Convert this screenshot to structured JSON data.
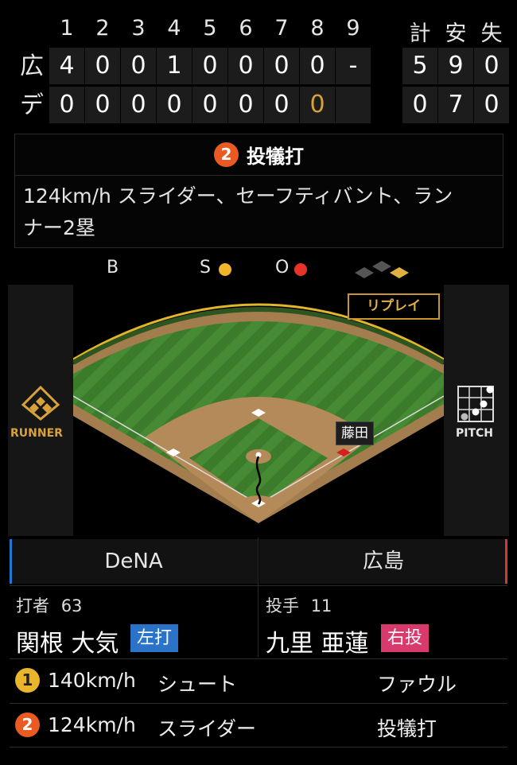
{
  "scoreboard": {
    "innings": [
      "1",
      "2",
      "3",
      "4",
      "5",
      "6",
      "7",
      "8",
      "9"
    ],
    "totals_headers": [
      "計",
      "安",
      "失"
    ],
    "teams": [
      {
        "abbr": "広",
        "innings": [
          "4",
          "0",
          "0",
          "1",
          "0",
          "0",
          "0",
          "0",
          "-"
        ],
        "totals": [
          "5",
          "9",
          "0"
        ]
      },
      {
        "abbr": "デ",
        "innings": [
          "0",
          "0",
          "0",
          "0",
          "0",
          "0",
          "0",
          "0",
          ""
        ],
        "totals": [
          "0",
          "7",
          "0"
        ]
      }
    ]
  },
  "play": {
    "number": "2",
    "title": "投犠打",
    "line1": "124km/h スライダー、セーフティバント、ラン",
    "line2": "ナー2塁"
  },
  "count": {
    "balls_label": "B",
    "strikes_label": "S",
    "outs_label": "O",
    "balls": 0,
    "strikes": 1,
    "outs": 1,
    "strike_color": "#f0b52a",
    "out_color": "#e8332a"
  },
  "field": {
    "replay_label": "リプレイ",
    "runner_label": "RUNNER",
    "pitch_label": "PITCH",
    "fielder_name": "藤田"
  },
  "teams": {
    "away": {
      "name": "DeNA",
      "color": "#1f78d1"
    },
    "home": {
      "name": "広島",
      "color": "#d23a2f"
    }
  },
  "batter": {
    "role": "打者",
    "number": "63",
    "name": "関根 大気",
    "hand": "左打",
    "hand_color": "#2a73c9"
  },
  "pitcher": {
    "role": "投手",
    "number": "11",
    "name": "九里 亜蓮",
    "hand": "右投",
    "hand_color": "#d83a6e"
  },
  "pitches": [
    {
      "num": "1",
      "speed": "140km/h",
      "type": "シュート",
      "result": "ファウル",
      "color": "yellow"
    },
    {
      "num": "2",
      "speed": "124km/h",
      "type": "スライダー",
      "result": "投犠打",
      "color": "orange"
    }
  ]
}
